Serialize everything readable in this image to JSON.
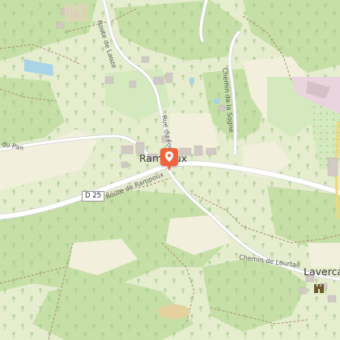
{
  "map": {
    "place_labels": {
      "village": "Rampoux",
      "hamlet_right": "Laverca"
    },
    "road_labels": {
      "route_de_lauze": "Route de Lauze",
      "rue_du_four": "Rue du Four",
      "chemin_sogne": "Chemin de la Sogne",
      "route_de_rampoux": "Route de Rampoux",
      "du_pan": "du Pan",
      "chemin_lourtail": "Chemin de Lourtail"
    },
    "road_shield": "D 25",
    "marker_icon": "location-pin-icon",
    "castle_icon": "castle-icon",
    "colors": {
      "forest": "#c6dfa7",
      "meadow": "#e6edcf",
      "field": "#f2f0dc",
      "orchard": "#d4e9bd",
      "road": "#ffffff",
      "water": "#a9d3e6",
      "marker": "#f2623c",
      "industrial": "#e8d4dc"
    }
  }
}
